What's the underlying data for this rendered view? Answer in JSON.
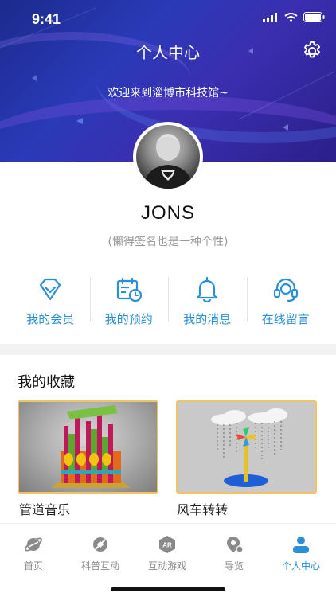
{
  "status": {
    "time": "9:41"
  },
  "header": {
    "title": "个人中心",
    "welcome": "欢迎来到淄博市科技馆~",
    "settings_icon": "gear-icon"
  },
  "profile": {
    "username": "JONS",
    "signature": "(懒得签名也是一种个性)"
  },
  "actions": [
    {
      "label": "我的会员",
      "icon": "diamond-icon"
    },
    {
      "label": "我的预约",
      "icon": "calendar-clock-icon"
    },
    {
      "label": "我的消息",
      "icon": "bell-icon"
    },
    {
      "label": "在线留言",
      "icon": "headset-icon"
    }
  ],
  "favorites": {
    "title": "我的收藏",
    "items": [
      {
        "name": "管道音乐"
      },
      {
        "name": "风车转转"
      }
    ]
  },
  "tabbar": {
    "items": [
      {
        "label": "首页",
        "icon": "planet-icon",
        "active": false
      },
      {
        "label": "科普互动",
        "icon": "satellite-icon",
        "active": false
      },
      {
        "label": "互动游戏",
        "icon": "ar-icon",
        "active": false
      },
      {
        "label": "导览",
        "icon": "map-pin-icon",
        "active": false
      },
      {
        "label": "个人中心",
        "icon": "user-icon",
        "active": true
      }
    ],
    "active_color": "#2a8fd6",
    "inactive_color": "#8a8a8a"
  },
  "colors": {
    "accent": "#2a8fd6",
    "card_border": "#f0c36a",
    "header_bg": "#2a3ab8"
  }
}
